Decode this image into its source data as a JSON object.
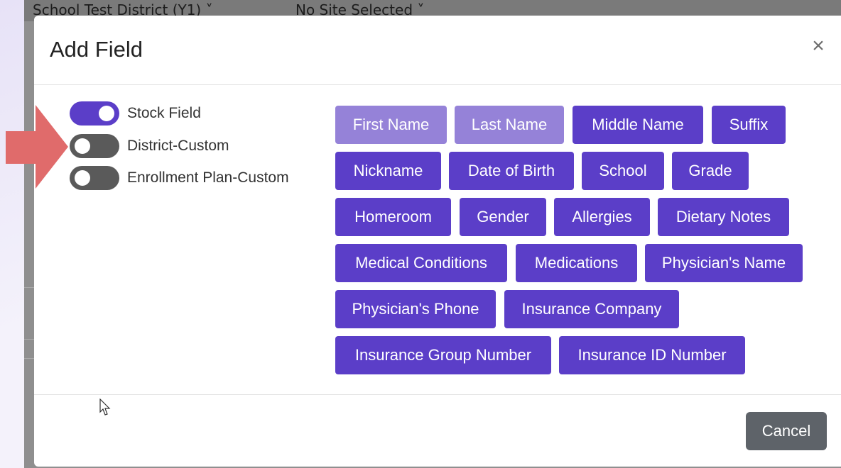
{
  "background": {
    "district_select": "School Test District (Y1) ˅",
    "site_select": "No Site Selected ˅"
  },
  "modal": {
    "title": "Add Field",
    "close_label": "×",
    "toggles": [
      {
        "label": "Stock Field",
        "state": "on"
      },
      {
        "label": "District-Custom",
        "state": "off"
      },
      {
        "label": "Enrollment Plan-Custom",
        "state": "off"
      }
    ],
    "fields": [
      {
        "label": "First Name",
        "selected": true
      },
      {
        "label": "Last Name",
        "selected": true
      },
      {
        "label": "Middle Name",
        "selected": false
      },
      {
        "label": "Suffix",
        "selected": false
      },
      {
        "label": "Nickname",
        "selected": false
      },
      {
        "label": "Date of Birth",
        "selected": false
      },
      {
        "label": "School",
        "selected": false
      },
      {
        "label": "Grade",
        "selected": false
      },
      {
        "label": "Homeroom",
        "selected": false
      },
      {
        "label": "Gender",
        "selected": false
      },
      {
        "label": "Allergies",
        "selected": false
      },
      {
        "label": "Dietary Notes",
        "selected": false
      },
      {
        "label": "Medical Conditions",
        "selected": false
      },
      {
        "label": "Medications",
        "selected": false
      },
      {
        "label": "Physician's Name",
        "selected": false
      },
      {
        "label": "Physician's Phone",
        "selected": false
      },
      {
        "label": "Insurance Company",
        "selected": false
      },
      {
        "label": "Insurance Group Number",
        "selected": false
      },
      {
        "label": "Insurance ID Number",
        "selected": false
      }
    ],
    "cancel_label": "Cancel"
  },
  "colors": {
    "accent": "#5b3ec8",
    "accent_light": "#9582d8",
    "toggle_off": "#5a5a5a",
    "cancel": "#5e6369",
    "annotation_arrow": "#e06b6b"
  }
}
